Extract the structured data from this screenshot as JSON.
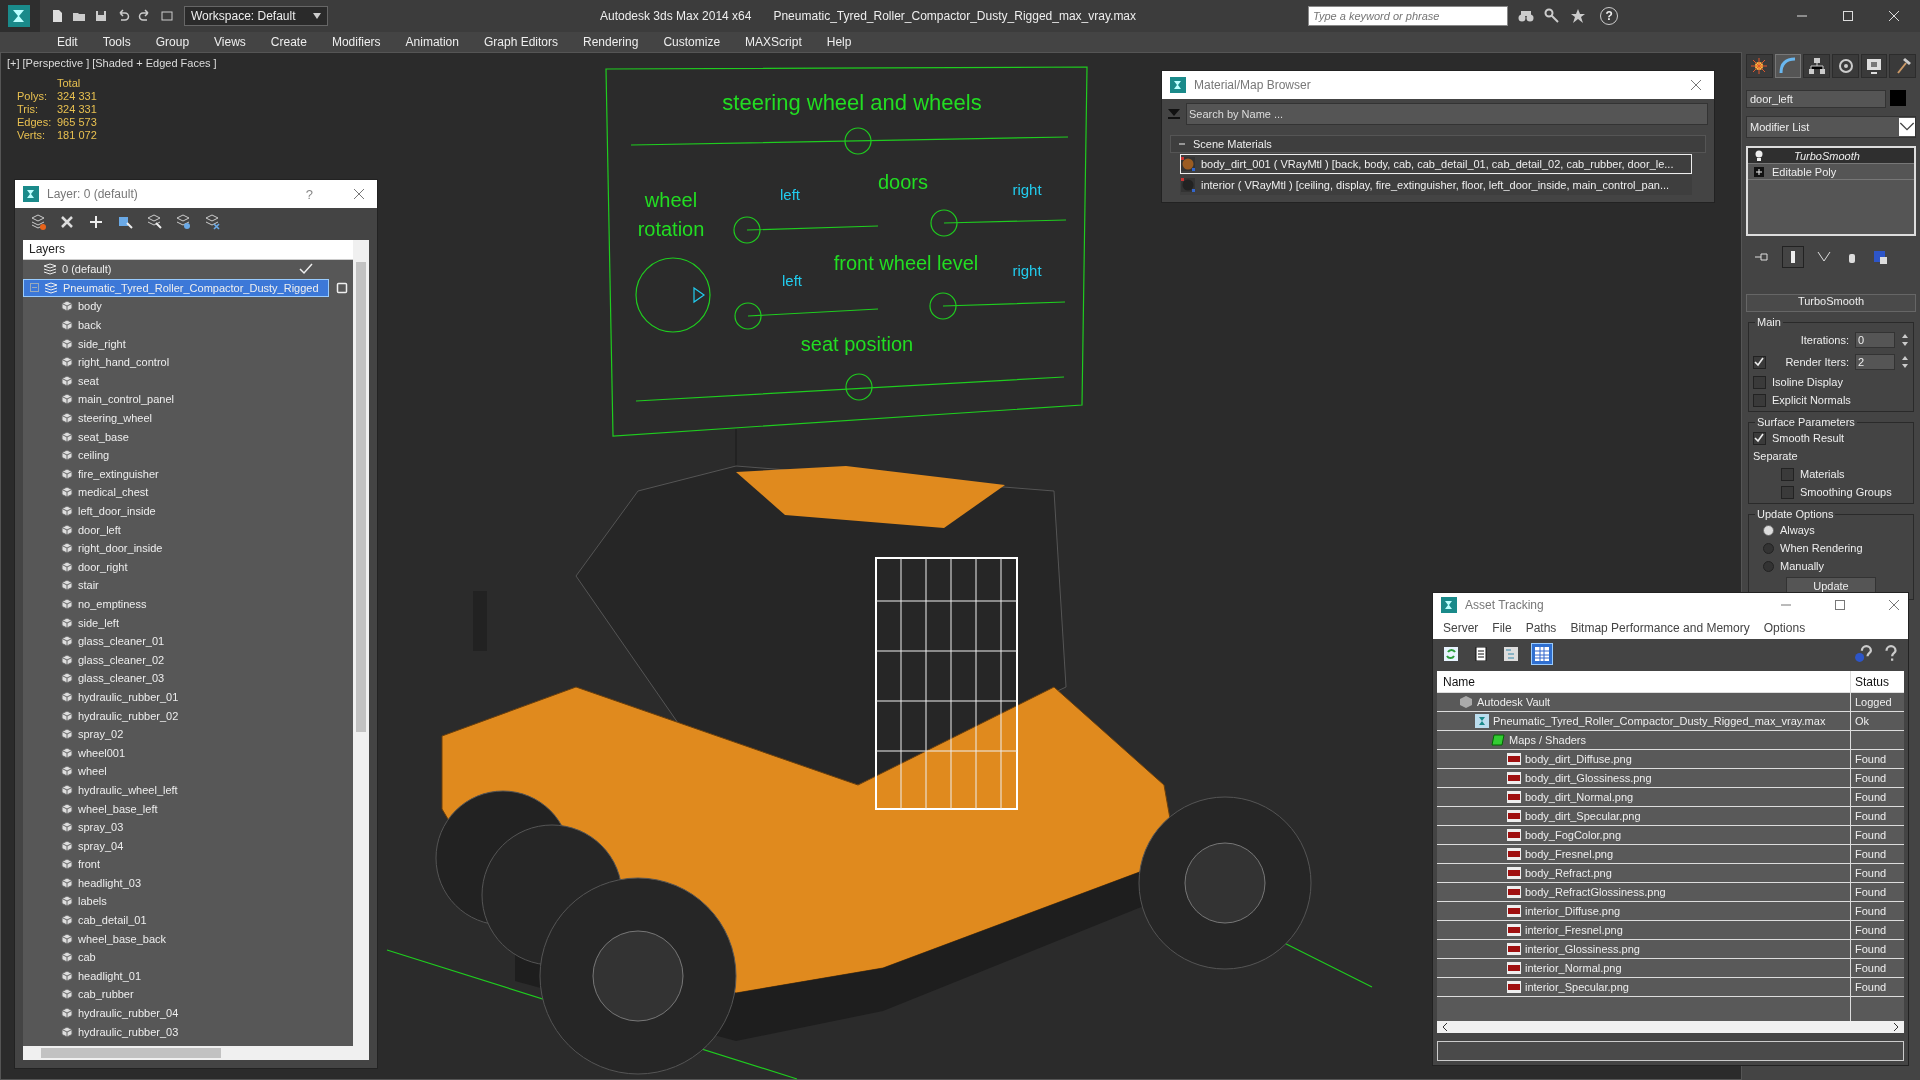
{
  "app": {
    "product": "Autodesk 3ds Max  2014 x64",
    "file": "Pneumatic_Tyred_Roller_Compactor_Dusty_Rigged_max_vray.max",
    "workspace": "Workspace: Default",
    "search_placeholder": "Type a keyword or phrase",
    "help_glyph": "?"
  },
  "menu": [
    "Edit",
    "Tools",
    "Group",
    "Views",
    "Create",
    "Modifiers",
    "Animation",
    "Graph Editors",
    "Rendering",
    "Customize",
    "MAXScript",
    "Help"
  ],
  "viewport": {
    "labels": [
      "[+]",
      "[Perspective ]",
      "[Shaded + Edged Faces ]"
    ],
    "stats": {
      "header": "Total",
      "rows": [
        {
          "label": "Polys:",
          "value": "324 331"
        },
        {
          "label": "Tris:",
          "value": "324 331"
        },
        {
          "label": "Edges:",
          "value": "965 573"
        },
        {
          "label": "Verts:",
          "value": "181 072"
        }
      ]
    },
    "hud_labels": [
      {
        "text": "steering wheel and wheels",
        "color": "#22dd22"
      },
      {
        "text": "wheel",
        "color": "#22dd22"
      },
      {
        "text": "rotation",
        "color": "#22dd22"
      },
      {
        "text": "left",
        "color": "#22ccee"
      },
      {
        "text": "doors",
        "color": "#22dd22"
      },
      {
        "text": "right",
        "color": "#22ccee"
      },
      {
        "text": "left",
        "color": "#22ccee"
      },
      {
        "text": "front wheel level",
        "color": "#22dd22"
      },
      {
        "text": "right",
        "color": "#22ccee"
      },
      {
        "text": "seat position",
        "color": "#22dd22"
      }
    ]
  },
  "layer_window": {
    "title": "Layer: 0 (default)",
    "help_glyph": "?",
    "header": "Layers",
    "layers": [
      {
        "name": "0 (default)",
        "current": true,
        "selected": false
      },
      {
        "name": "Pneumatic_Tyred_Roller_Compactor_Dusty_Rigged",
        "current": false,
        "selected": true,
        "expanded": true,
        "children": [
          {
            "name": "body"
          },
          {
            "name": "back"
          },
          {
            "name": "side_right"
          },
          {
            "name": "right_hand_control"
          },
          {
            "name": "seat"
          },
          {
            "name": "main_control_panel"
          },
          {
            "name": "steering_wheel"
          },
          {
            "name": "seat_base"
          },
          {
            "name": "ceiling"
          },
          {
            "name": "fire_extinguisher"
          },
          {
            "name": "medical_chest"
          },
          {
            "name": "left_door_inside"
          },
          {
            "name": "door_left"
          },
          {
            "name": "right_door_inside"
          },
          {
            "name": "door_right"
          },
          {
            "name": "stair"
          },
          {
            "name": "no_emptiness"
          },
          {
            "name": "side_left"
          },
          {
            "name": "glass_cleaner_01"
          },
          {
            "name": "glass_cleaner_02"
          },
          {
            "name": "glass_cleaner_03"
          },
          {
            "name": "hydraulic_rubber_01"
          },
          {
            "name": "hydraulic_rubber_02"
          },
          {
            "name": "spray_02"
          },
          {
            "name": "wheel001"
          },
          {
            "name": "wheel"
          },
          {
            "name": "hydraulic_wheel_left"
          },
          {
            "name": "wheel_base_left"
          },
          {
            "name": "spray_03"
          },
          {
            "name": "spray_04"
          },
          {
            "name": "front"
          },
          {
            "name": "headlight_03"
          },
          {
            "name": "labels"
          },
          {
            "name": "cab_detail_01"
          },
          {
            "name": "wheel_base_back"
          },
          {
            "name": "cab"
          },
          {
            "name": "headlight_01"
          },
          {
            "name": "cab_rubber"
          },
          {
            "name": "hydraulic_rubber_04"
          },
          {
            "name": "hydraulic_rubber_03"
          }
        ]
      }
    ]
  },
  "material_browser": {
    "title": "Material/Map Browser",
    "search_placeholder": "Search by Name ...",
    "group": "Scene Materials",
    "items": [
      {
        "text": "body_dirt_001 ( VRayMtl ) [back, body, cab, cab_detail_01, cab_detail_02, cab_rubber, door_le...",
        "selected": true
      },
      {
        "text": "interior ( VRayMtl ) [ceiling, display, fire_extinguisher, floor, left_door_inside, main_control_pan...",
        "selected": false
      }
    ]
  },
  "command_panel": {
    "tabs": [
      {
        "selected": false
      },
      {
        "selected": true
      },
      {
        "selected": false
      },
      {
        "selected": false
      },
      {
        "selected": false
      },
      {
        "selected": false
      }
    ],
    "object_name": "door_left",
    "modifier_list": "Modifier List",
    "stack": [
      {
        "name": "TurboSmooth",
        "kind": "modifier",
        "selected": true
      },
      {
        "name": "Editable Poly",
        "kind": "base",
        "selected": false
      }
    ],
    "rollout": "TurboSmooth",
    "groups": [
      {
        "title": "Main",
        "rows": [
          {
            "kind": "spinner",
            "label": "Iterations:",
            "value": "0"
          },
          {
            "kind": "check_spinner",
            "label": "Render Iters:",
            "value": "2",
            "checked": true
          },
          {
            "kind": "checkbox",
            "label": "Isoline Display",
            "checked": false
          },
          {
            "kind": "checkbox",
            "label": "Explicit Normals",
            "checked": false
          }
        ]
      },
      {
        "title": "Surface Parameters",
        "rows": [
          {
            "kind": "checkbox",
            "label": "Smooth Result",
            "checked": true
          },
          {
            "kind": "caption",
            "label": "Separate"
          },
          {
            "kind": "sub_checkbox",
            "label": "Materials",
            "checked": false
          },
          {
            "kind": "sub_checkbox",
            "label": "Smoothing Groups",
            "checked": false
          }
        ]
      },
      {
        "title": "Update Options",
        "rows": [
          {
            "kind": "radio",
            "label": "Always",
            "selected": true
          },
          {
            "kind": "radio",
            "label": "When Rendering",
            "selected": false
          },
          {
            "kind": "radio",
            "label": "Manually",
            "selected": false
          },
          {
            "kind": "button",
            "label": "Update"
          }
        ]
      }
    ]
  },
  "asset_tracking": {
    "title": "Asset Tracking",
    "menu": [
      "Server",
      "File",
      "Paths",
      "Bitmap Performance and Memory",
      "Options"
    ],
    "view_buttons": [
      {
        "selected": false
      },
      {
        "selected": false
      },
      {
        "selected": false
      },
      {
        "selected": true
      }
    ],
    "columns": [
      "Name",
      "Status"
    ],
    "tree": [
      {
        "name": "Autodesk Vault",
        "status": "Logged",
        "kind": "vault",
        "children": [
          {
            "name": "Pneumatic_Tyred_Roller_Compactor_Dusty_Rigged_max_vray.max",
            "status": "Ok",
            "kind": "scene",
            "children": [
              {
                "name": "Maps / Shaders",
                "kind": "folder",
                "children": [
                  {
                    "name": "body_dirt_Diffuse.png",
                    "status": "Found",
                    "kind": "png"
                  },
                  {
                    "name": "body_dirt_Glossiness.png",
                    "status": "Found",
                    "kind": "png"
                  },
                  {
                    "name": "body_dirt_Normal.png",
                    "status": "Found",
                    "kind": "png"
                  },
                  {
                    "name": "body_dirt_Specular.png",
                    "status": "Found",
                    "kind": "png"
                  },
                  {
                    "name": "body_FogColor.png",
                    "status": "Found",
                    "kind": "png"
                  },
                  {
                    "name": "body_Fresnel.png",
                    "status": "Found",
                    "kind": "png"
                  },
                  {
                    "name": "body_Refract.png",
                    "status": "Found",
                    "kind": "png"
                  },
                  {
                    "name": "body_RefractGlossiness.png",
                    "status": "Found",
                    "kind": "png"
                  },
                  {
                    "name": "interior_Diffuse.png",
                    "status": "Found",
                    "kind": "png"
                  },
                  {
                    "name": "interior_Fresnel.png",
                    "status": "Found",
                    "kind": "png"
                  },
                  {
                    "name": "interior_Glossiness.png",
                    "status": "Found",
                    "kind": "png"
                  },
                  {
                    "name": "interior_Normal.png",
                    "status": "Found",
                    "kind": "png"
                  },
                  {
                    "name": "interior_Specular.png",
                    "status": "Found",
                    "kind": "png"
                  }
                ]
              }
            ]
          }
        ]
      }
    ]
  }
}
